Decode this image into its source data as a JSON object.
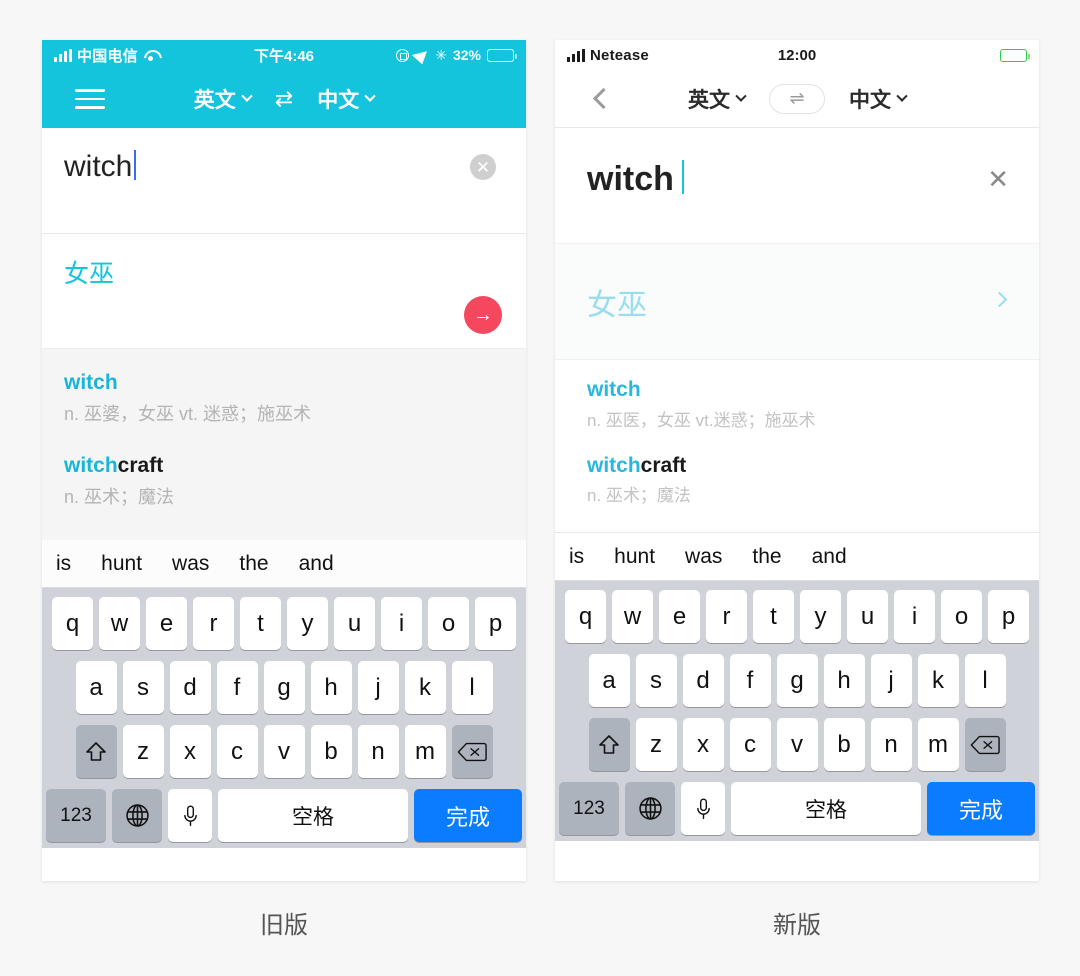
{
  "page": {
    "background": "#f7f7f7"
  },
  "colors": {
    "teal": "#14c4dd",
    "teal_light": "#9adeee",
    "link_blue": "#19b5d8",
    "accent_pink": "#f5485f",
    "done_blue": "#0a7cff",
    "battery_green": "#2ecc4a"
  },
  "old": {
    "caption": "旧版",
    "status": {
      "signal_icon": "signal-bars-icon",
      "carrier": "中国电信",
      "wifi_icon": "wifi-icon",
      "time": "下午4:46",
      "rotation_lock_icon": "rotation-lock-icon",
      "location_icon": "location-arrow-icon",
      "bluetooth_icon": "bluetooth-icon",
      "bluetooth_glyph": "✳",
      "battery_percent": "32%",
      "battery_icon": "battery-icon"
    },
    "nav": {
      "menu_icon": "hamburger-menu-icon",
      "source_lang": "英文",
      "swap_icon": "swap-arrows-icon",
      "swap_glyph": "⇄",
      "target_lang": "中文",
      "caret_icon": "chevron-down-icon"
    },
    "search": {
      "value": "witch",
      "placeholder": "",
      "clear_icon": "clear-circle-icon",
      "clear_glyph": "✕"
    },
    "result": {
      "translation": "女巫",
      "go_icon": "arrow-right-circle-icon",
      "go_glyph": "→"
    },
    "suggestions": [
      {
        "word_match": "witch",
        "word_rest": "",
        "definition": "n. 巫婆，女巫 vt. 迷惑；施巫术"
      },
      {
        "word_match": "witch",
        "word_rest": "craft",
        "definition": "n. 巫术；魔法"
      }
    ]
  },
  "new": {
    "caption": "新版",
    "status": {
      "signal_icon": "signal-bars-icon",
      "carrier": "Netease",
      "time": "12:00",
      "battery_icon": "battery-icon"
    },
    "nav": {
      "back_icon": "chevron-left-back-icon",
      "source_lang": "英文",
      "swap_icon": "swap-arrows-icon",
      "swap_glyph": "⇌",
      "target_lang": "中文",
      "caret_icon": "chevron-down-icon"
    },
    "search": {
      "value": "witch",
      "placeholder": "",
      "clear_icon": "clear-x-icon",
      "clear_glyph": "✕"
    },
    "result": {
      "translation": "女巫",
      "go_icon": "chevron-right-icon"
    },
    "suggestions": [
      {
        "word_match": "witch",
        "word_rest": "",
        "definition": "n. 巫医，女巫  vt.迷惑；施巫术"
      },
      {
        "word_match": "witch",
        "word_rest": "craft",
        "definition": "n. 巫术；魔法"
      }
    ]
  },
  "keyboard": {
    "predictions": [
      "is",
      "hunt",
      "was",
      "the",
      "and"
    ],
    "row1": [
      "q",
      "w",
      "e",
      "r",
      "t",
      "y",
      "u",
      "i",
      "o",
      "p"
    ],
    "row2": [
      "a",
      "s",
      "d",
      "f",
      "g",
      "h",
      "j",
      "k",
      "l"
    ],
    "row3": [
      "z",
      "x",
      "c",
      "v",
      "b",
      "n",
      "m"
    ],
    "shift_icon": "shift-arrow-icon",
    "backspace_icon": "backspace-icon",
    "numeric_label": "123",
    "globe_icon": "globe-keyboard-icon",
    "mic_icon": "microphone-icon",
    "space_label": "空格",
    "done_label": "完成"
  }
}
